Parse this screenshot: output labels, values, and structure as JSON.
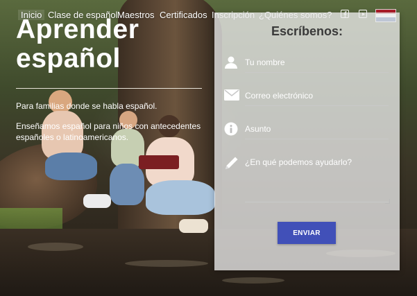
{
  "nav": {
    "items": [
      {
        "label": "Inicio",
        "active": true
      },
      {
        "label": "Clase de español"
      },
      {
        "label": "Maestros"
      },
      {
        "label": "Certificados"
      },
      {
        "label": "Inscripción"
      },
      {
        "label": "¿Quiénes somos?"
      }
    ],
    "icons": [
      "facebook-icon",
      "youtube-icon"
    ],
    "language_flag": {
      "icon": "netherlands-flag",
      "colors": [
        "#ae1c28",
        "#ffffff",
        "#21468b"
      ]
    }
  },
  "hero": {
    "title_line1": "Aprender",
    "title_line2": "español",
    "text1": "Para familias donde se habla español.",
    "text2": "Enseñamos español para niños con antecedentes españoles o latinoamericanos."
  },
  "form": {
    "title": "Escríbenos:",
    "fields": [
      {
        "icon": "user-icon",
        "placeholder": "Tu nombre"
      },
      {
        "icon": "envelope-icon",
        "placeholder": "Correo electrónico"
      },
      {
        "icon": "info-icon",
        "placeholder": "Asunto"
      },
      {
        "icon": "pencil-icon",
        "placeholder": "¿En qué podemos ayudarlo?"
      }
    ],
    "submit_label": "ENVIAR",
    "accent_color": "#4150b8"
  }
}
